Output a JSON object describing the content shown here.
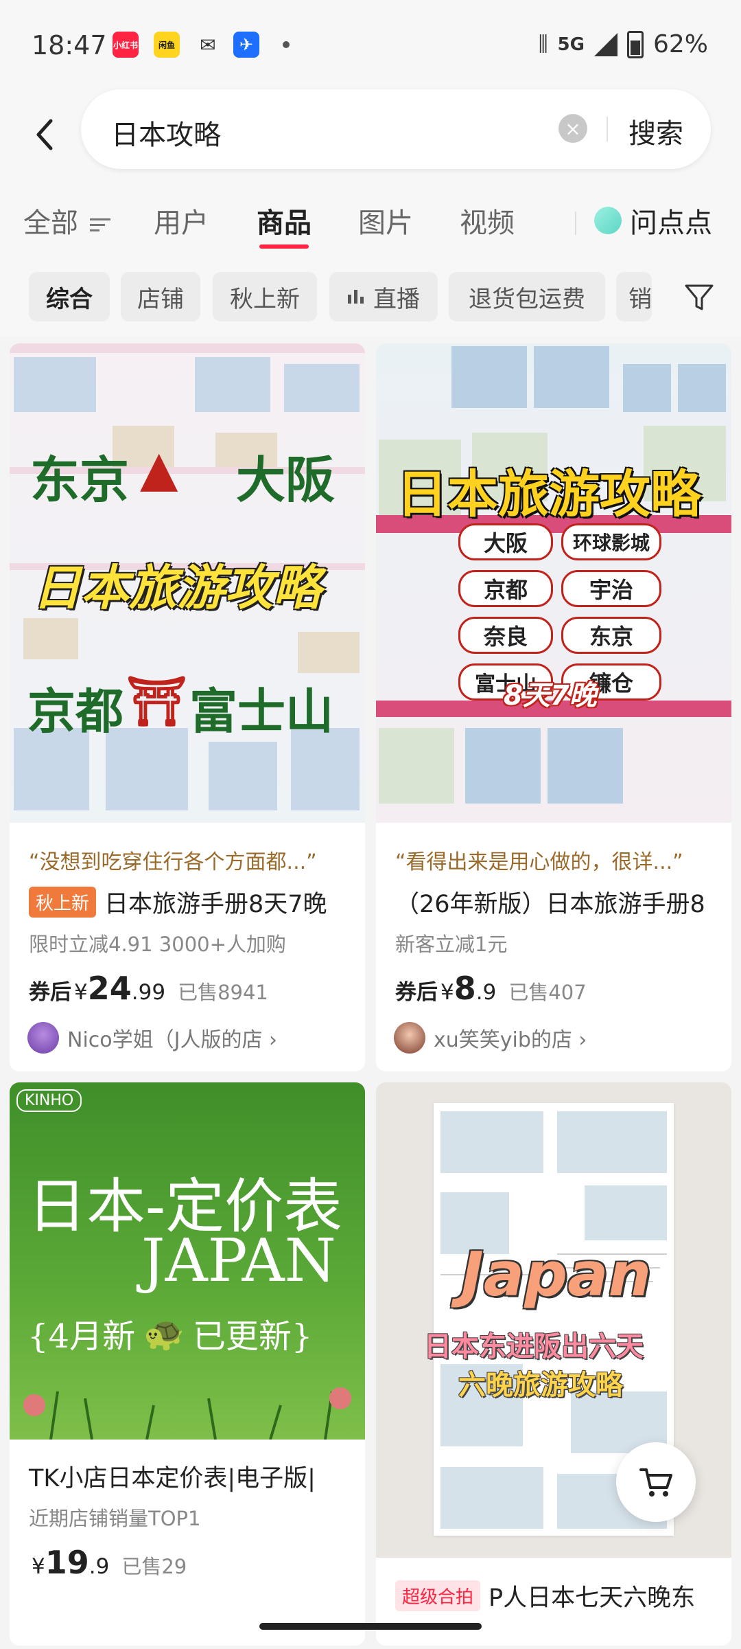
{
  "status_bar": {
    "time": "18:47",
    "apps": [
      {
        "label": "小红书",
        "color": "#ff2442"
      },
      {
        "label": "闲鱼",
        "color": "#ffd41f"
      },
      {
        "label": "✉",
        "color": "#333333"
      },
      {
        "label": "✈",
        "color": "#1f6fff"
      }
    ],
    "network": "5G",
    "battery": "62%"
  },
  "search": {
    "query": "日本攻略",
    "button": "搜索"
  },
  "tabs": [
    {
      "label": "全部",
      "active": false
    },
    {
      "label": "用户",
      "active": false
    },
    {
      "label": "商品",
      "active": true
    },
    {
      "label": "图片",
      "active": false
    },
    {
      "label": "视频",
      "active": false
    }
  ],
  "tabs_extra": "问点点",
  "chips": [
    "综合",
    "店铺",
    "秋上新",
    "直播",
    "退货包运费",
    "销"
  ],
  "products": [
    {
      "quote": "“没想到吃穿住行各个方面都...”",
      "tag": "秋上新",
      "title": "日本旅游手册8天7晚",
      "meta": "限时立减4.91   3000+人加购",
      "price_prefix": "券后",
      "currency": "¥",
      "price_int": "24",
      "price_dec": ".99",
      "sold": "已售8941",
      "shop": "Nico学姐（J人版的店 ›",
      "cover": {
        "line1a": "东京",
        "line1b": "大阪",
        "main": "日本旅游攻略",
        "line3a": "京都",
        "line3b": "富士山"
      }
    },
    {
      "quote": "“看得出来是用心做的，很详...”",
      "title": "（26年新版）日本旅游手册8",
      "meta": "新客立减1元",
      "price_prefix": "券后",
      "currency": "¥",
      "price_int": "8",
      "price_dec": ".9",
      "sold": "已售407",
      "shop": "xu笑笑yib的店 ›",
      "cover": {
        "main": "日本旅游攻略",
        "cities": [
          "大阪",
          "环球影城",
          "京都",
          "宇治",
          "奈良",
          "东京",
          "富士山",
          "镰仓"
        ],
        "badge": "8天7晚"
      }
    },
    {
      "title": "TK小店日本定价表|电子版|",
      "meta": "近期店铺销量TOP1",
      "currency": "¥",
      "price_int": "19",
      "price_dec": ".9",
      "sold": "已售29",
      "cover": {
        "brand": "KINHO",
        "line1": "日本-定价表",
        "line2": "JAPAN",
        "line3": "{4月新",
        "line3b": "已更新}"
      }
    },
    {
      "tag": "超级合拍",
      "title": "P人日本七天六晚东",
      "cover": {
        "script": "Japan",
        "line1": "日本东进阪出六天",
        "line2": "六晚旅游攻略"
      }
    }
  ],
  "colors": {
    "accent": "#ff2442",
    "tag_orange": "#f07a3c",
    "green_card": "#4e9a2f"
  }
}
